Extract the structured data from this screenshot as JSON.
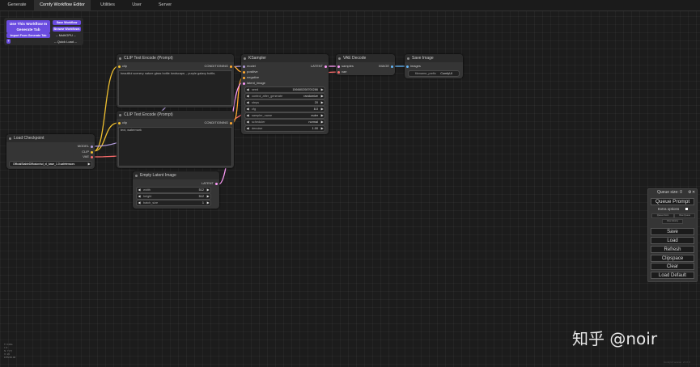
{
  "tabs": [
    "Generate",
    "Comfy Workflow Editor",
    "Utilities",
    "User",
    "Server"
  ],
  "workflow_panel": {
    "use_workflow": "Use This Workflow In Generate Tab",
    "import_from_generate": "Import From Generate Tab",
    "save_workflow": "Save Workflow",
    "browse_workflows": "Browse Workflows",
    "multi_gpu": "-- MultiGPU --",
    "quick_load": "-- Quick Load --"
  },
  "nodes": {
    "clip1": {
      "title": "CLIP Text Encode (Prompt)",
      "in": "clip",
      "out": "CONDITIONING",
      "text": "beautiful scenery nature glass bottle landscape, , purple galaxy bottle,"
    },
    "clip2": {
      "title": "CLIP Text Encode (Prompt)",
      "in": "clip",
      "out": "CONDITIONING",
      "text": "text, watermark"
    },
    "ksampler": {
      "title": "KSampler",
      "inputs": [
        "model",
        "positive",
        "negative",
        "latent_image"
      ],
      "out": "LATENT",
      "widgets": [
        {
          "name": "seed",
          "value": "156680208700286"
        },
        {
          "name": "control_after_generate",
          "value": "randomize"
        },
        {
          "name": "steps",
          "value": "20"
        },
        {
          "name": "cfg",
          "value": "8.0"
        },
        {
          "name": "sampler_name",
          "value": "euler"
        },
        {
          "name": "scheduler",
          "value": "normal"
        },
        {
          "name": "denoise",
          "value": "1.00"
        }
      ]
    },
    "vae": {
      "title": "VAE Decode",
      "inputs": [
        "samples",
        "vae"
      ],
      "out": "IMAGE"
    },
    "save": {
      "title": "Save Image",
      "in": "images",
      "prefix_name": "filename_prefix",
      "prefix_value": "ComfyUI"
    },
    "ckpt": {
      "title": "Load Checkpoint",
      "outs": [
        "MODEL",
        "CLIP",
        "VAE"
      ],
      "ckpt_name": "ckpt_name",
      "ckpt_value": "OfficialStableDiffusion/sd_xl_base_1.0.safetensors"
    },
    "latent": {
      "title": "Empty Latent Image",
      "out": "LATENT",
      "widgets": [
        {
          "name": "width",
          "value": "512"
        },
        {
          "name": "height",
          "value": "512"
        },
        {
          "name": "batch_size",
          "value": "1"
        }
      ]
    }
  },
  "queue": {
    "size_label": "Queue size: 0",
    "queue_prompt": "Queue Prompt",
    "extra_options": "Extra options",
    "view_queue": "View Queue",
    "view_history": "View History",
    "queue_front": "Queue Front",
    "save": "Save",
    "load": "Load",
    "refresh": "Refresh",
    "clipspace": "Clipspace",
    "clear": "Clear",
    "load_default": "Load Default"
  },
  "watermark": "知乎 @noir",
  "stats": [
    "T: 0.00s",
    "I: 0",
    "N: 7 [7]",
    "V: 16",
    "FPS:60.00"
  ],
  "version": "ComfyUI version: vX.X.X",
  "colors": {
    "clip_wire": "#f0c030",
    "model_wire": "#b39ddb",
    "vae_wire": "#ff6e6e",
    "latent_wire": "#ff9cf9",
    "cond_wire": "#ffa931",
    "image_wire": "#64b5f6",
    "accent": "#6a4ce0"
  }
}
